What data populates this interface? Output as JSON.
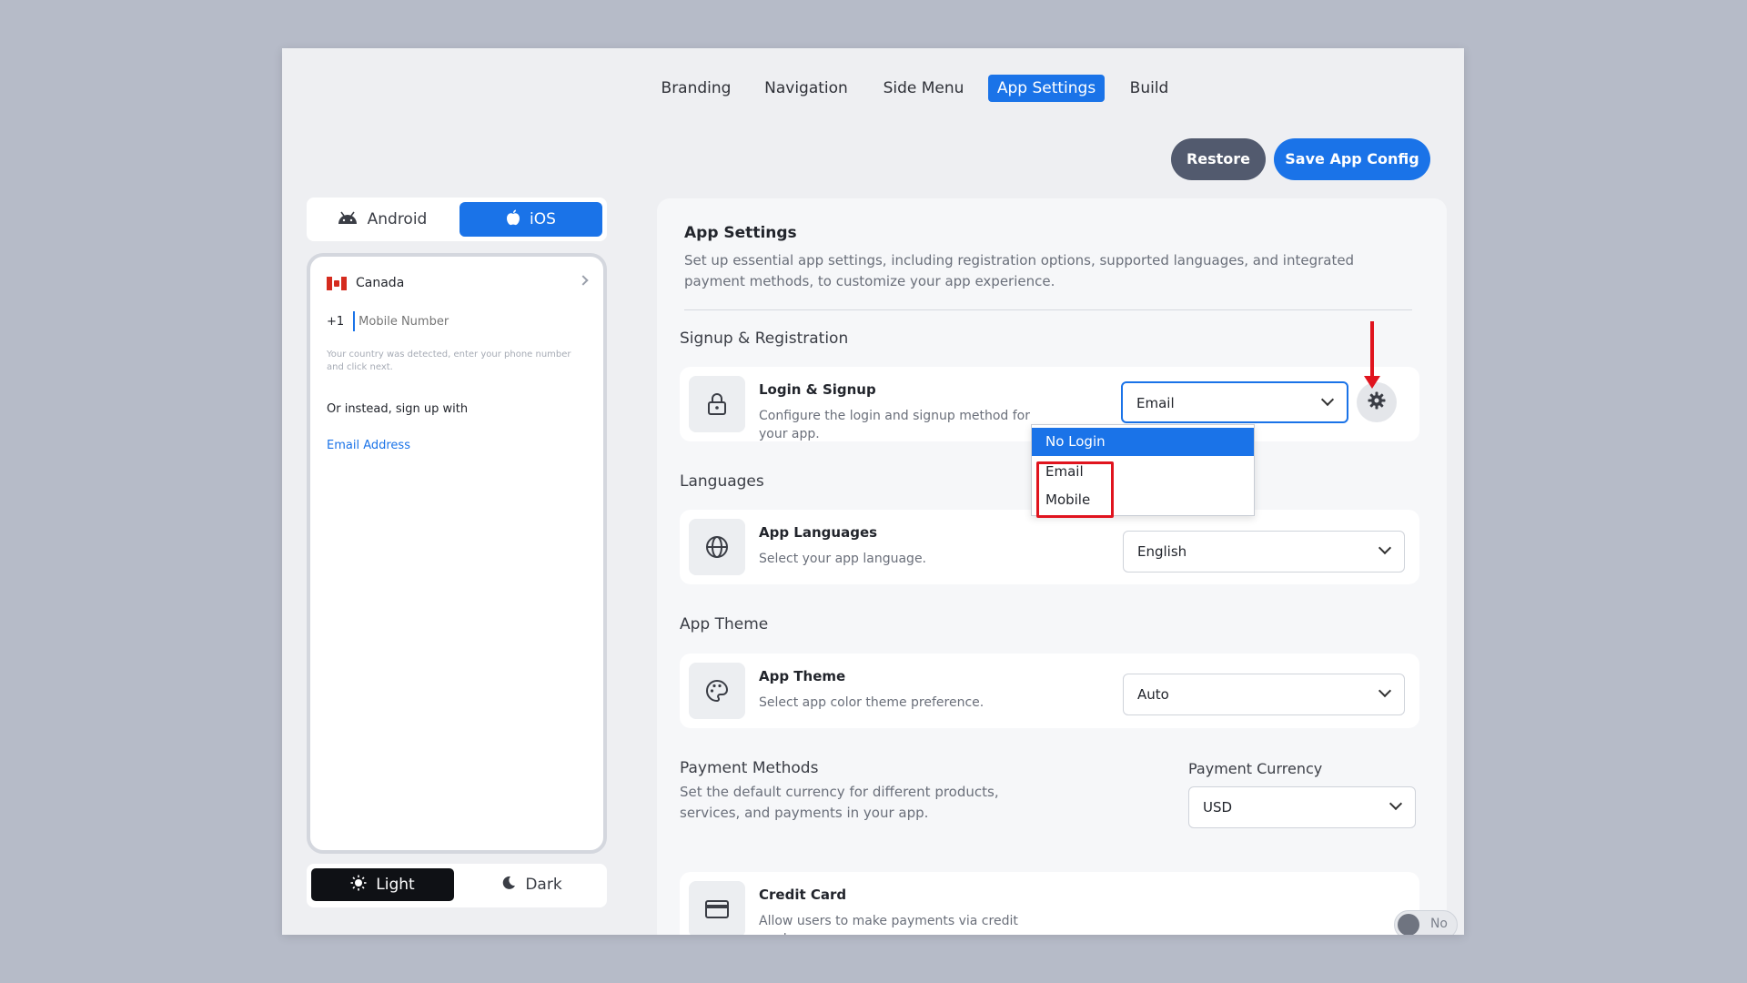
{
  "nav": {
    "tabs": [
      {
        "label": "Branding"
      },
      {
        "label": "Navigation"
      },
      {
        "label": "Side Menu"
      },
      {
        "label": "App Settings"
      },
      {
        "label": "Build"
      }
    ],
    "active_tab": "App Settings"
  },
  "actions": {
    "restore_label": "Restore",
    "save_label": "Save App Config"
  },
  "os_toggle": {
    "android_label": "Android",
    "ios_label": "iOS",
    "selected": "iOS"
  },
  "preview": {
    "country": "Canada",
    "dial_code": "+1",
    "mobile_placeholder": "Mobile Number",
    "help_text": "Your country was detected, enter your phone number and click next.",
    "alt_signup_text": "Or instead, sign up with",
    "email_link": "Email Address"
  },
  "theme_toggle": {
    "light_label": "Light",
    "dark_label": "Dark",
    "selected": "Light"
  },
  "settings": {
    "title": "App Settings",
    "description": "Set up essential app settings, including registration options, supported languages, and integrated payment methods, to customize your app experience.",
    "signup": {
      "section_title": "Signup & Registration",
      "card_title": "Login & Signup",
      "card_desc": "Configure the login and signup method for your app.",
      "selected": "Email",
      "options": [
        "No Login",
        "Email",
        "Mobile"
      ],
      "highlighted_option": "No Login"
    },
    "languages": {
      "section_title": "Languages",
      "card_title": "App Languages",
      "card_desc": "Select your app language.",
      "selected": "English"
    },
    "theme": {
      "section_title": "App Theme",
      "card_title": "App Theme",
      "card_desc": "Select app color theme preference.",
      "selected": "Auto"
    },
    "payment": {
      "section_title": "Payment Methods",
      "description": "Set the default currency for different products, services, and payments in your app.",
      "currency_label": "Payment Currency",
      "currency": "USD",
      "credit_card": {
        "title": "Credit Card",
        "desc": "Allow users to make payments via credit cards.",
        "toggle_label": "No"
      }
    }
  },
  "colors": {
    "accent": "#1a73e8",
    "annotation": "#e0141e",
    "dark_button": "#525a6e"
  }
}
